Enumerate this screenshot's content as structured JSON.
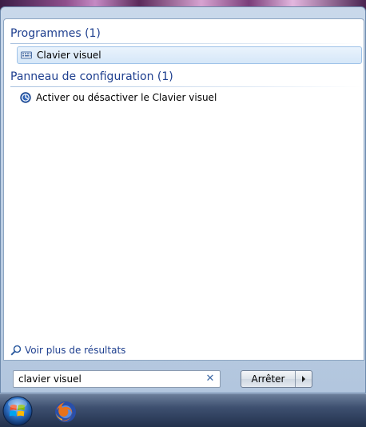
{
  "groups": [
    {
      "title": "Programmes (1)",
      "items": [
        {
          "label": "Clavier visuel",
          "icon": "keyboard-icon",
          "selected": true
        }
      ]
    },
    {
      "title": "Panneau de configuration (1)",
      "items": [
        {
          "label": "Activer ou désactiver le Clavier visuel",
          "icon": "ease-of-access-icon",
          "selected": false
        }
      ]
    }
  ],
  "more_results": {
    "label": "Voir plus de résultats",
    "icon": "search-icon"
  },
  "search": {
    "value": "clavier visuel",
    "clear_icon": "clear-icon"
  },
  "shutdown": {
    "label": "Arrêter",
    "arrow_icon": "chevron-right-icon"
  },
  "taskbar": {
    "items": [
      "start-orb-icon",
      "firefox-icon"
    ]
  },
  "colors": {
    "header_text": "#1e3f8f",
    "selection_bg": "#d6e7f8",
    "taskbar": "#22314d"
  }
}
